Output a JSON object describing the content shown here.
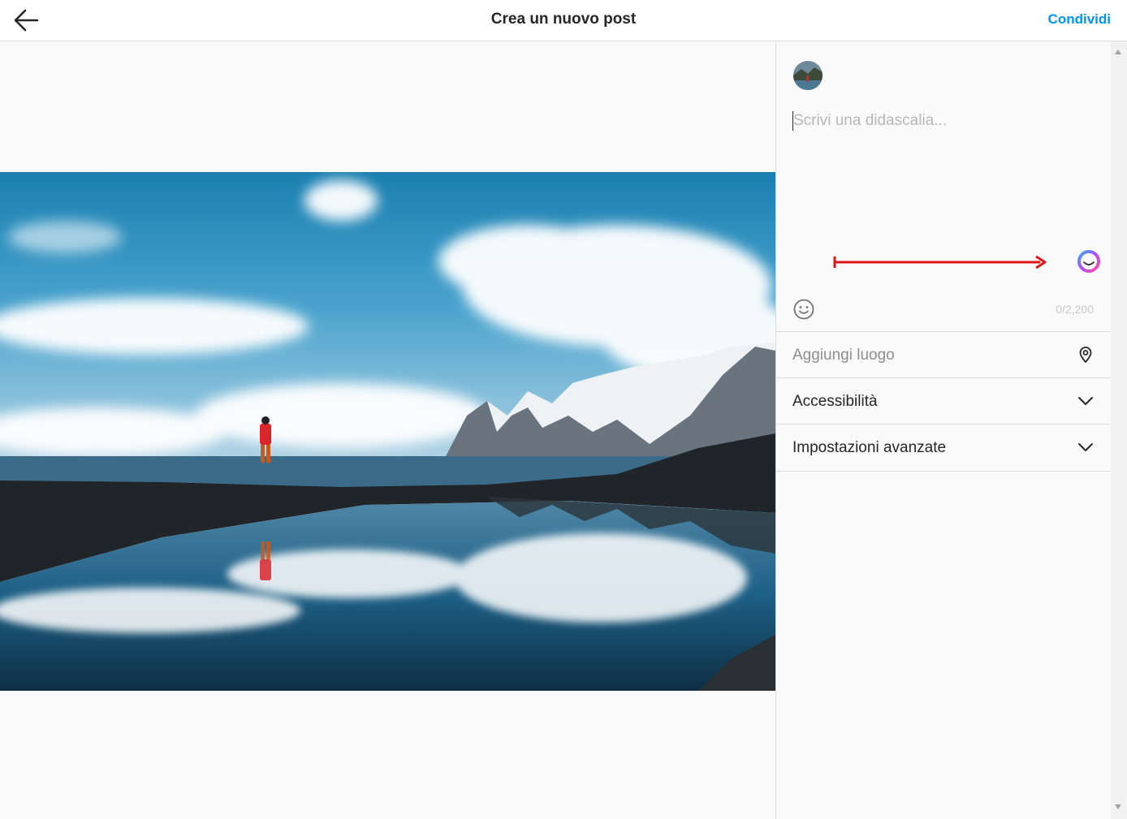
{
  "header": {
    "title": "Crea un nuovo post",
    "share_label": "Condividi",
    "back_icon": "arrow-left-icon"
  },
  "composer": {
    "caption_placeholder": "Scrivi una didascalia...",
    "char_count": "0/2,200",
    "emoji_icon": "smiley-icon",
    "ai_icon": "meta-ai-icon"
  },
  "options": {
    "location_label": "Aggiungi luogo",
    "location_icon": "location-pin-icon",
    "accessibility_label": "Accessibilità",
    "advanced_label": "Impostazioni avanzate",
    "chevron_icon": "chevron-down-icon"
  },
  "colors": {
    "accent": "#0095f6",
    "annotation_arrow": "#e0141b"
  }
}
